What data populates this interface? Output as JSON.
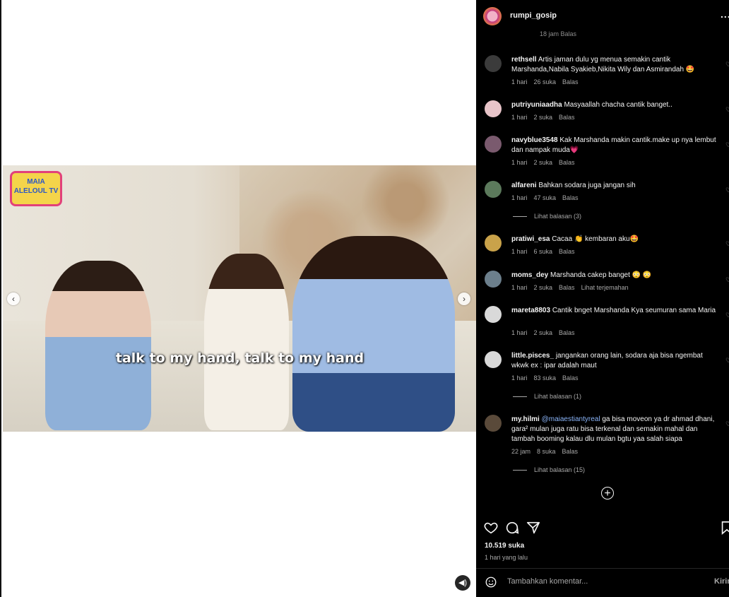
{
  "media": {
    "subtitle": "talk to my hand, talk to my hand",
    "logo_text": "MAIA ALELOUL TV",
    "prev_icon": "chevron-left-icon",
    "next_icon": "chevron-right-icon",
    "mute_icon": "speaker-icon"
  },
  "header": {
    "username": "rumpi_gosip",
    "more_label": "..."
  },
  "ghost_meta": "18 jam   Balas",
  "comments": [
    {
      "user": "rethsell",
      "text": "Artis jaman dulu yg menua semakin cantik Marshanda,Nabila Syakieb,Nikita Wily dan Asmirandah 🤩",
      "time": "1 hari",
      "likes": "26 suka",
      "reply": "Balas"
    },
    {
      "user": "putriyuniaadha",
      "text": "Masyaallah chacha cantik banget..",
      "time": "1 hari",
      "likes": "2 suka",
      "reply": "Balas"
    },
    {
      "user": "navyblue3548",
      "text": "Kak Marshanda makin cantik.make up nya lembut dan nampak muda💗",
      "time": "1 hari",
      "likes": "2 suka",
      "reply": "Balas"
    },
    {
      "user": "alfareni",
      "text": "Bahkan sodara juga jangan sih",
      "time": "1 hari",
      "likes": "47 suka",
      "reply": "Balas",
      "replies": "Lihat balasan (3)"
    },
    {
      "user": "pratiwi_esa",
      "text": "Cacaa 👏 kembaran aku🤩",
      "time": "1 hari",
      "likes": "6 suka",
      "reply": "Balas"
    },
    {
      "user": "moms_dey",
      "text": "Marshanda cakep banget 😳 😳",
      "time": "1 hari",
      "likes": "2 suka",
      "reply": "Balas",
      "translate": "Lihat terjemahan"
    },
    {
      "user": "mareta8803",
      "text": "Cantik bnget Marshanda Kya seumuran sama Maria",
      "time": "1 hari",
      "likes": "2 suka",
      "reply": "Balas"
    },
    {
      "user": "little.pisces_",
      "text": "jangankan orang lain, sodara aja bisa ngembat wkwk ex : ipar adalah maut",
      "time": "1 hari",
      "likes": "83 suka",
      "reply": "Balas",
      "replies": "Lihat balasan (1)"
    },
    {
      "user": "my.hilmi",
      "mention": "@maiaestiantyreal",
      "text": " ga bisa moveon ya dr ahmad dhani, gara² mulan juga ratu bisa terkenal dan semakin mahal dan tambah booming kalau dlu mulan bgtu yaa salah siapa",
      "time": "22 jam",
      "likes": "8 suka",
      "reply": "Balas",
      "replies": "Lihat balasan (15)"
    }
  ],
  "footer": {
    "likes": "10.519 suka",
    "date": "1 hari yang lalu",
    "comment_placeholder": "Tambahkan komentar...",
    "post_label": "Kirim"
  }
}
